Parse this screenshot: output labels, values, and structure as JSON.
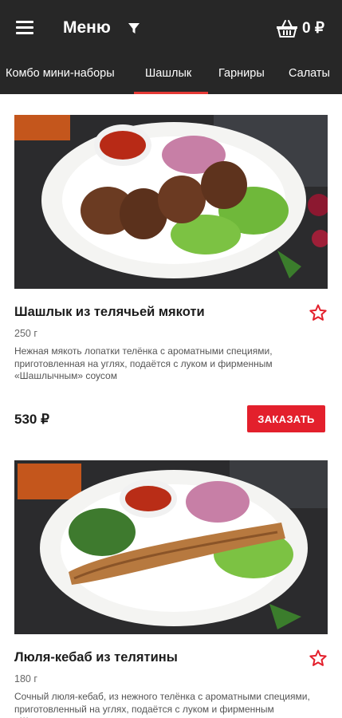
{
  "header": {
    "title": "Меню",
    "cart_total": "0 ₽",
    "icons": [
      "menu-icon",
      "filter-icon",
      "basket-icon"
    ]
  },
  "tabs": [
    {
      "label": "Комбо мини-наборы",
      "active": false
    },
    {
      "label": "Шашлык",
      "active": true
    },
    {
      "label": "Гарниры",
      "active": false
    },
    {
      "label": "Салаты",
      "active": false
    }
  ],
  "products": [
    {
      "name": "Шашлык из телячьей мякоти",
      "weight": "250 г",
      "description": "Нежная мякоть лопатки телёнка с ароматными специями, приготовленная на углях, подаётся с луком и фирменным «Шашлычным» соусом",
      "price": "530 ₽",
      "order_label": "ЗАКАЗАТЬ"
    },
    {
      "name": "Люля-кебаб из телятины",
      "weight": "180 г",
      "description": "Сочный люля-кебаб, из нежного телёнка с ароматными специями, приготовленный на углях, подаётся с луком и фирменным «Шашлычным» соусом"
    }
  ],
  "colors": {
    "header_bg": "#272727",
    "accent": "#e3202c",
    "text": "#1b1b1b"
  }
}
